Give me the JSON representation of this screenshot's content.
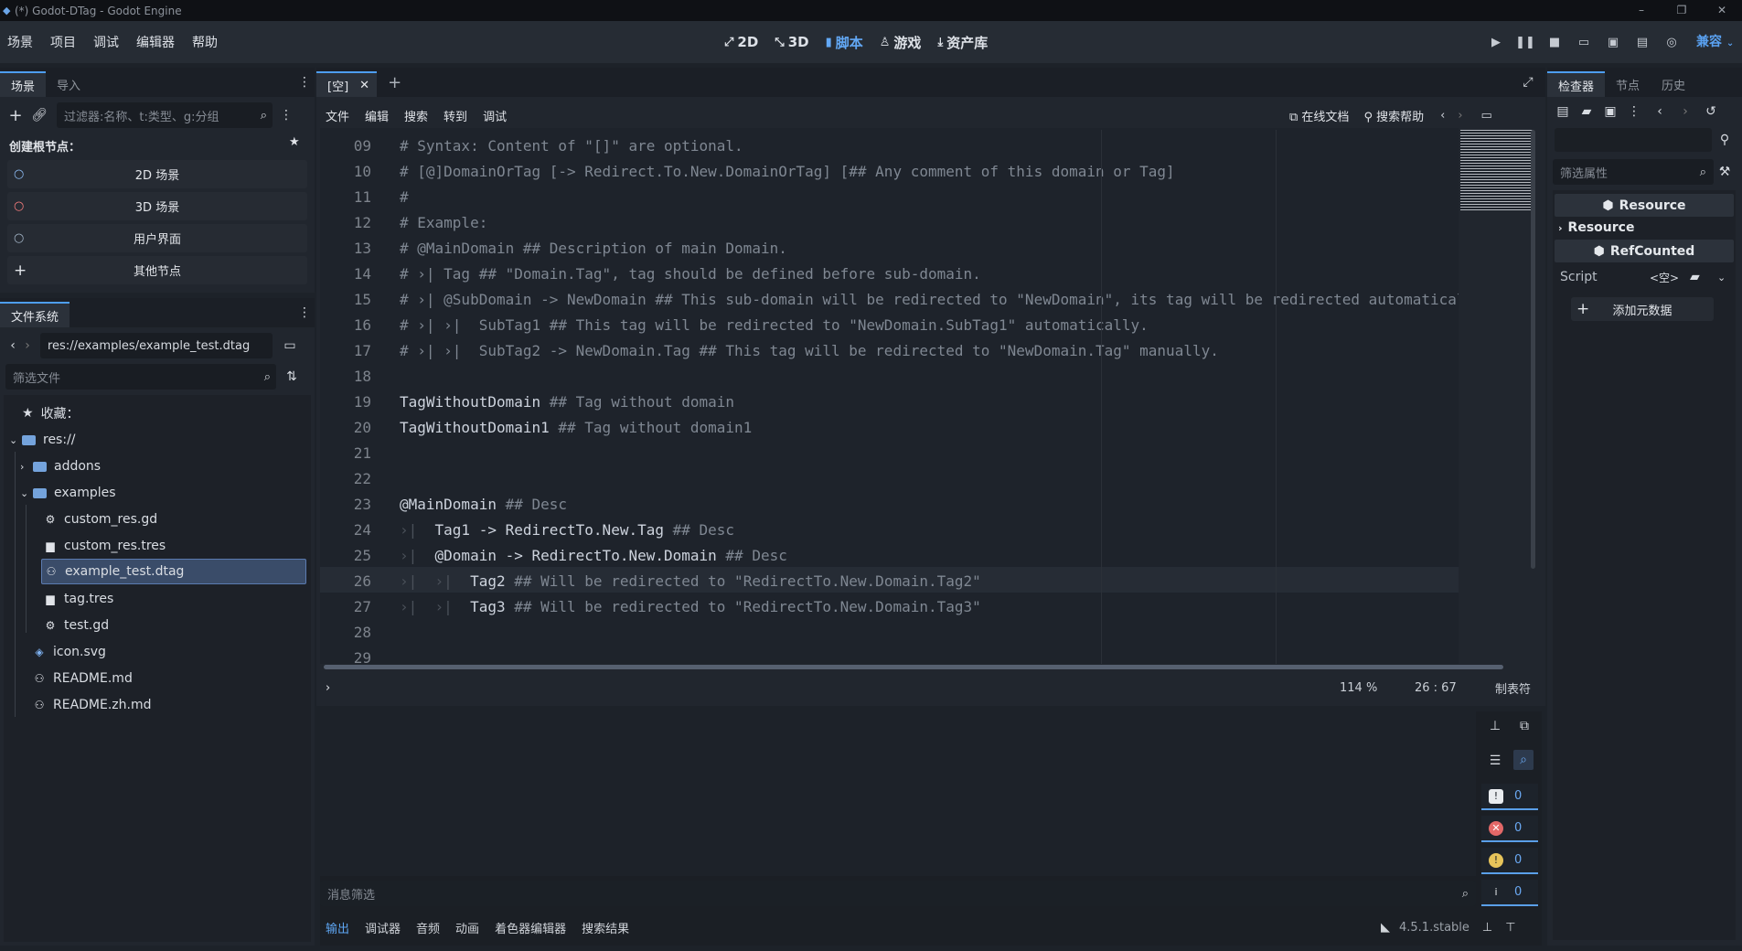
{
  "window": {
    "title": "(*) Godot-DTag - Godot Engine",
    "controls": [
      "–",
      "❐",
      "✕"
    ]
  },
  "menu": [
    "场景",
    "项目",
    "调试",
    "编辑器",
    "帮助"
  ],
  "main_screens": [
    {
      "label": "2D",
      "glyph": "⤢",
      "active": false
    },
    {
      "label": "3D",
      "glyph": "⤡",
      "active": false
    },
    {
      "label": "脚本",
      "glyph": "▮",
      "active": true
    },
    {
      "label": "游戏",
      "glyph": "♙",
      "active": false
    },
    {
      "label": "资产库",
      "glyph": "⤓",
      "active": false
    }
  ],
  "renderer": "兼容",
  "scene_dock": {
    "tabs": [
      "场景",
      "导入"
    ],
    "filter_placeholder": "过滤器:名称、t:类型、g:分组",
    "create_root": "创建根节点：",
    "nodes": [
      {
        "label": "2D 场景",
        "color": "#8fbef7"
      },
      {
        "label": "3D 场景",
        "color": "#fc7f7f"
      },
      {
        "label": "用户界面",
        "color": "#a5b7c9"
      },
      {
        "label": "其他节点",
        "color": "#e0e0e0"
      }
    ]
  },
  "fs_dock": {
    "tab": "文件系统",
    "path": "res://examples/example_test.dtag",
    "filter_placeholder": "筛选文件",
    "favorites": "收藏：",
    "tree": [
      {
        "label": "res://",
        "type": "folder"
      },
      {
        "label": "addons",
        "type": "folder"
      },
      {
        "label": "examples",
        "type": "folder"
      },
      {
        "label": "custom_res.gd",
        "type": "gear"
      },
      {
        "label": "custom_res.tres",
        "type": "doc"
      },
      {
        "label": "example_test.dtag",
        "type": "dtag"
      },
      {
        "label": "tag.tres",
        "type": "doc"
      },
      {
        "label": "test.gd",
        "type": "gear"
      },
      {
        "label": "icon.svg",
        "type": "image"
      },
      {
        "label": "README.md",
        "type": "dtag"
      },
      {
        "label": "README.zh.md",
        "type": "dtag"
      }
    ]
  },
  "script_editor": {
    "tab": "[空]",
    "menu": [
      "文件",
      "编辑",
      "搜索",
      "转到",
      "调试"
    ],
    "online_docs": "在线文档",
    "search_help": "搜索帮助",
    "lines": [
      {
        "n": "09",
        "text": "# Syntax: Content of \"[]\" are optional.",
        "kind": "cm"
      },
      {
        "n": "10",
        "text": "# [@]DomainOrTag [-> Redirect.To.New.DomainOrTag] [## Any comment of this domain or Tag]",
        "kind": "cm"
      },
      {
        "n": "11",
        "text": "#",
        "kind": "cm"
      },
      {
        "n": "12",
        "text": "# Example:",
        "kind": "cm"
      },
      {
        "n": "13",
        "text": "# @MainDomain ## Description of main Domain.",
        "kind": "cm"
      },
      {
        "n": "14",
        "text": "# ›| Tag ## \"Domain.Tag\", tag should be defined before sub-domain.",
        "kind": "cm"
      },
      {
        "n": "15",
        "text": "# ›| @SubDomain -> NewDomain ## This sub-domain will be redirected to \"NewDomain\", its tag will be redirected automatical",
        "kind": "cm"
      },
      {
        "n": "16",
        "text": "# ›| ›|  SubTag1 ## This tag will be redirected to \"NewDomain.SubTag1\" automatically.",
        "kind": "cm"
      },
      {
        "n": "17",
        "text": "# ›| ›|  SubTag2 -> NewDomain.Tag ## This tag will be redirected to \"NewDomain.Tag\" manually.",
        "kind": "cm"
      },
      {
        "n": "18",
        "text": "",
        "kind": "code"
      },
      {
        "n": "19",
        "code": "TagWithoutDomain ",
        "comment": "## Tag without domain",
        "kind": "mix"
      },
      {
        "n": "20",
        "code": "TagWithoutDomain1 ",
        "comment": "## Tag without domain1",
        "kind": "mix"
      },
      {
        "n": "21",
        "text": "",
        "kind": "code"
      },
      {
        "n": "22",
        "text": "",
        "kind": "code"
      },
      {
        "n": "23",
        "code": "@MainDomain ",
        "comment": "## Desc",
        "kind": "mix"
      },
      {
        "n": "24",
        "tabs": "›|  ",
        "code": "Tag1 -> RedirectTo.New.Tag ",
        "comment": "## Desc",
        "kind": "mix"
      },
      {
        "n": "25",
        "tabs": "›|  ",
        "code": "@Domain -> RedirectTo.New.Domain ",
        "comment": "## Desc",
        "kind": "mix"
      },
      {
        "n": "26",
        "tabs": "›|  ›|  ",
        "code": "Tag2 ",
        "comment": "## Will be redirected to \"RedirectTo.New.Domain.Tag2\"",
        "kind": "mix"
      },
      {
        "n": "27",
        "tabs": "›|  ›|  ",
        "code": "Tag3 ",
        "comment": "## Will be redirected to \"RedirectTo.New.Domain.Tag3\"",
        "kind": "mix"
      },
      {
        "n": "28",
        "text": "",
        "kind": "code"
      },
      {
        "n": "29",
        "text": "",
        "kind": "code"
      }
    ],
    "zoom": "114 %",
    "cursor": "26 :  67",
    "indent": "制表符"
  },
  "output": {
    "filter_placeholder": "消息筛选",
    "counters": [
      {
        "value": "0",
        "glyph": "!",
        "color": "#e9ecef"
      },
      {
        "value": "0",
        "glyph": "✕",
        "color": "#e36868"
      },
      {
        "value": "0",
        "glyph": "!",
        "color": "#e7c45a"
      },
      {
        "value": "0",
        "glyph": "i",
        "color": "#e9ecef"
      }
    ],
    "tabs": [
      "输出",
      "调试器",
      "音频",
      "动画",
      "着色器编辑器",
      "搜索结果"
    ],
    "version": "4.5.1.stable"
  },
  "inspector": {
    "tabs": [
      "检查器",
      "节点",
      "历史"
    ],
    "filter_placeholder": "筛选属性",
    "resource_header": "Resource",
    "resource_section": "Resource",
    "refcounted": "RefCounted",
    "script_label": "Script",
    "script_value": "<空>",
    "add_metadata": "添加元数据"
  }
}
